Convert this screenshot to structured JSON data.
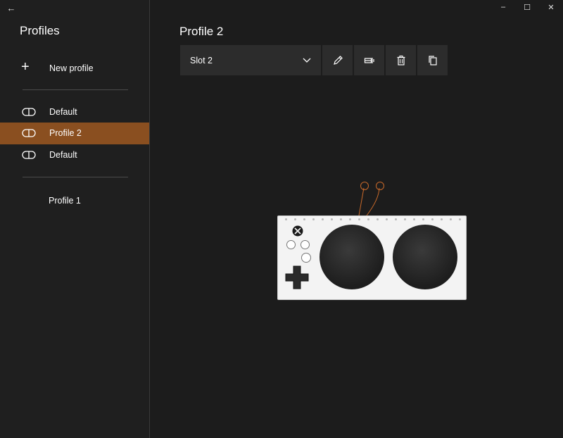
{
  "window": {
    "back_glyph": "←",
    "minimize_glyph": "–",
    "maximize_glyph": "☐",
    "close_glyph": "✕"
  },
  "sidebar": {
    "title": "Profiles",
    "new_profile_label": "New profile",
    "new_profile_icon": "plus-icon",
    "items": [
      {
        "label": "Default",
        "icon": "slot-icon",
        "selected": false
      },
      {
        "label": "Profile 2",
        "icon": "slot-icon",
        "selected": true
      },
      {
        "label": "Default",
        "icon": "slot-icon",
        "selected": false
      }
    ],
    "extra_profiles": [
      {
        "label": "Profile 1"
      }
    ]
  },
  "main": {
    "page_title": "Profile 2",
    "slot_select": {
      "value": "Slot 2"
    },
    "toolbar_buttons": [
      {
        "name": "edit",
        "icon": "pencil-icon"
      },
      {
        "name": "assign",
        "icon": "controller-map-icon"
      },
      {
        "name": "delete",
        "icon": "trash-icon"
      },
      {
        "name": "copy",
        "icon": "copy-icon"
      }
    ]
  },
  "colors": {
    "accent": "#8a4f20",
    "callout": "#c8692a",
    "background": "#1c1c1c",
    "panel": "#2c2c2c"
  }
}
